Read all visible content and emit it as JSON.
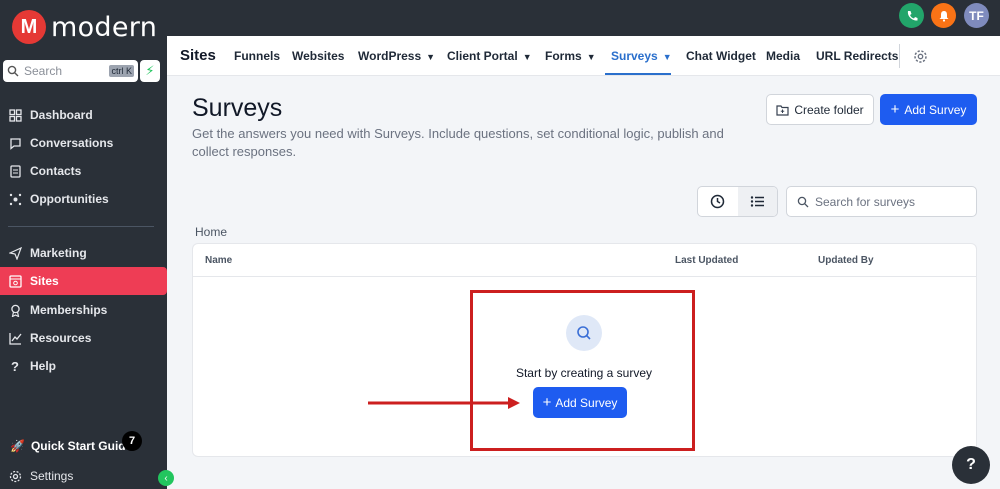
{
  "brand": {
    "name": "modern",
    "logo_letter": "M",
    "accent": "#e53935"
  },
  "sidebar": {
    "search_placeholder": "Search",
    "search_shortcut": "ctrl K",
    "items": [
      {
        "label": "Dashboard",
        "icon": "dashboard-icon"
      },
      {
        "label": "Conversations",
        "icon": "chat-icon"
      },
      {
        "label": "Contacts",
        "icon": "contacts-icon"
      },
      {
        "label": "Opportunities",
        "icon": "opportunities-icon"
      },
      {
        "label": "Marketing",
        "icon": "send-icon"
      },
      {
        "label": "Sites",
        "icon": "sites-icon",
        "active": true
      },
      {
        "label": "Memberships",
        "icon": "award-icon"
      },
      {
        "label": "Resources",
        "icon": "chart-icon"
      },
      {
        "label": "Help",
        "icon": "help-icon"
      }
    ],
    "quick_start": {
      "label": "Quick Start Guide",
      "badge": "7"
    },
    "settings_label": "Settings"
  },
  "topbar": {
    "avatar_initials": "TF"
  },
  "subnav": {
    "title": "Sites",
    "tabs": [
      {
        "label": "Funnels"
      },
      {
        "label": "Websites"
      },
      {
        "label": "WordPress",
        "dropdown": true
      },
      {
        "label": "Client Portal",
        "dropdown": true
      },
      {
        "label": "Forms",
        "dropdown": true
      },
      {
        "label": "Surveys",
        "dropdown": true,
        "active": true
      },
      {
        "label": "Chat Widget"
      },
      {
        "label": "Media"
      },
      {
        "label": "URL Redirects"
      }
    ]
  },
  "main": {
    "title": "Surveys",
    "description": "Get the answers you need with Surveys. Include questions, set conditional logic, publish and collect responses.",
    "create_folder_label": "Create folder",
    "add_survey_label": "Add Survey",
    "search_placeholder": "Search for surveys",
    "breadcrumb": "Home",
    "columns": [
      "Name",
      "Last Updated",
      "Updated By"
    ],
    "empty_text": "Start by creating a survey",
    "empty_button_label": "Add Survey"
  },
  "colors": {
    "primary": "#1e5cf0",
    "active_nav": "#ee3d55",
    "sidebar_bg": "#2a3038",
    "annotation": "#cc1f1f"
  }
}
